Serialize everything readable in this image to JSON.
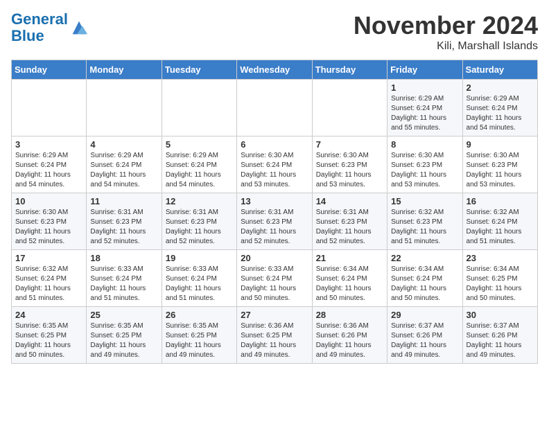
{
  "logo": {
    "line1": "General",
    "line2": "Blue"
  },
  "title": "November 2024",
  "location": "Kili, Marshall Islands",
  "days_of_week": [
    "Sunday",
    "Monday",
    "Tuesday",
    "Wednesday",
    "Thursday",
    "Friday",
    "Saturday"
  ],
  "weeks": [
    [
      {
        "day": "",
        "info": ""
      },
      {
        "day": "",
        "info": ""
      },
      {
        "day": "",
        "info": ""
      },
      {
        "day": "",
        "info": ""
      },
      {
        "day": "",
        "info": ""
      },
      {
        "day": "1",
        "info": "Sunrise: 6:29 AM\nSunset: 6:24 PM\nDaylight: 11 hours\nand 55 minutes."
      },
      {
        "day": "2",
        "info": "Sunrise: 6:29 AM\nSunset: 6:24 PM\nDaylight: 11 hours\nand 54 minutes."
      }
    ],
    [
      {
        "day": "3",
        "info": "Sunrise: 6:29 AM\nSunset: 6:24 PM\nDaylight: 11 hours\nand 54 minutes."
      },
      {
        "day": "4",
        "info": "Sunrise: 6:29 AM\nSunset: 6:24 PM\nDaylight: 11 hours\nand 54 minutes."
      },
      {
        "day": "5",
        "info": "Sunrise: 6:29 AM\nSunset: 6:24 PM\nDaylight: 11 hours\nand 54 minutes."
      },
      {
        "day": "6",
        "info": "Sunrise: 6:30 AM\nSunset: 6:24 PM\nDaylight: 11 hours\nand 53 minutes."
      },
      {
        "day": "7",
        "info": "Sunrise: 6:30 AM\nSunset: 6:23 PM\nDaylight: 11 hours\nand 53 minutes."
      },
      {
        "day": "8",
        "info": "Sunrise: 6:30 AM\nSunset: 6:23 PM\nDaylight: 11 hours\nand 53 minutes."
      },
      {
        "day": "9",
        "info": "Sunrise: 6:30 AM\nSunset: 6:23 PM\nDaylight: 11 hours\nand 53 minutes."
      }
    ],
    [
      {
        "day": "10",
        "info": "Sunrise: 6:30 AM\nSunset: 6:23 PM\nDaylight: 11 hours\nand 52 minutes."
      },
      {
        "day": "11",
        "info": "Sunrise: 6:31 AM\nSunset: 6:23 PM\nDaylight: 11 hours\nand 52 minutes."
      },
      {
        "day": "12",
        "info": "Sunrise: 6:31 AM\nSunset: 6:23 PM\nDaylight: 11 hours\nand 52 minutes."
      },
      {
        "day": "13",
        "info": "Sunrise: 6:31 AM\nSunset: 6:23 PM\nDaylight: 11 hours\nand 52 minutes."
      },
      {
        "day": "14",
        "info": "Sunrise: 6:31 AM\nSunset: 6:23 PM\nDaylight: 11 hours\nand 52 minutes."
      },
      {
        "day": "15",
        "info": "Sunrise: 6:32 AM\nSunset: 6:23 PM\nDaylight: 11 hours\nand 51 minutes."
      },
      {
        "day": "16",
        "info": "Sunrise: 6:32 AM\nSunset: 6:24 PM\nDaylight: 11 hours\nand 51 minutes."
      }
    ],
    [
      {
        "day": "17",
        "info": "Sunrise: 6:32 AM\nSunset: 6:24 PM\nDaylight: 11 hours\nand 51 minutes."
      },
      {
        "day": "18",
        "info": "Sunrise: 6:33 AM\nSunset: 6:24 PM\nDaylight: 11 hours\nand 51 minutes."
      },
      {
        "day": "19",
        "info": "Sunrise: 6:33 AM\nSunset: 6:24 PM\nDaylight: 11 hours\nand 51 minutes."
      },
      {
        "day": "20",
        "info": "Sunrise: 6:33 AM\nSunset: 6:24 PM\nDaylight: 11 hours\nand 50 minutes."
      },
      {
        "day": "21",
        "info": "Sunrise: 6:34 AM\nSunset: 6:24 PM\nDaylight: 11 hours\nand 50 minutes."
      },
      {
        "day": "22",
        "info": "Sunrise: 6:34 AM\nSunset: 6:24 PM\nDaylight: 11 hours\nand 50 minutes."
      },
      {
        "day": "23",
        "info": "Sunrise: 6:34 AM\nSunset: 6:25 PM\nDaylight: 11 hours\nand 50 minutes."
      }
    ],
    [
      {
        "day": "24",
        "info": "Sunrise: 6:35 AM\nSunset: 6:25 PM\nDaylight: 11 hours\nand 50 minutes."
      },
      {
        "day": "25",
        "info": "Sunrise: 6:35 AM\nSunset: 6:25 PM\nDaylight: 11 hours\nand 49 minutes."
      },
      {
        "day": "26",
        "info": "Sunrise: 6:35 AM\nSunset: 6:25 PM\nDaylight: 11 hours\nand 49 minutes."
      },
      {
        "day": "27",
        "info": "Sunrise: 6:36 AM\nSunset: 6:25 PM\nDaylight: 11 hours\nand 49 minutes."
      },
      {
        "day": "28",
        "info": "Sunrise: 6:36 AM\nSunset: 6:26 PM\nDaylight: 11 hours\nand 49 minutes."
      },
      {
        "day": "29",
        "info": "Sunrise: 6:37 AM\nSunset: 6:26 PM\nDaylight: 11 hours\nand 49 minutes."
      },
      {
        "day": "30",
        "info": "Sunrise: 6:37 AM\nSunset: 6:26 PM\nDaylight: 11 hours\nand 49 minutes."
      }
    ]
  ]
}
